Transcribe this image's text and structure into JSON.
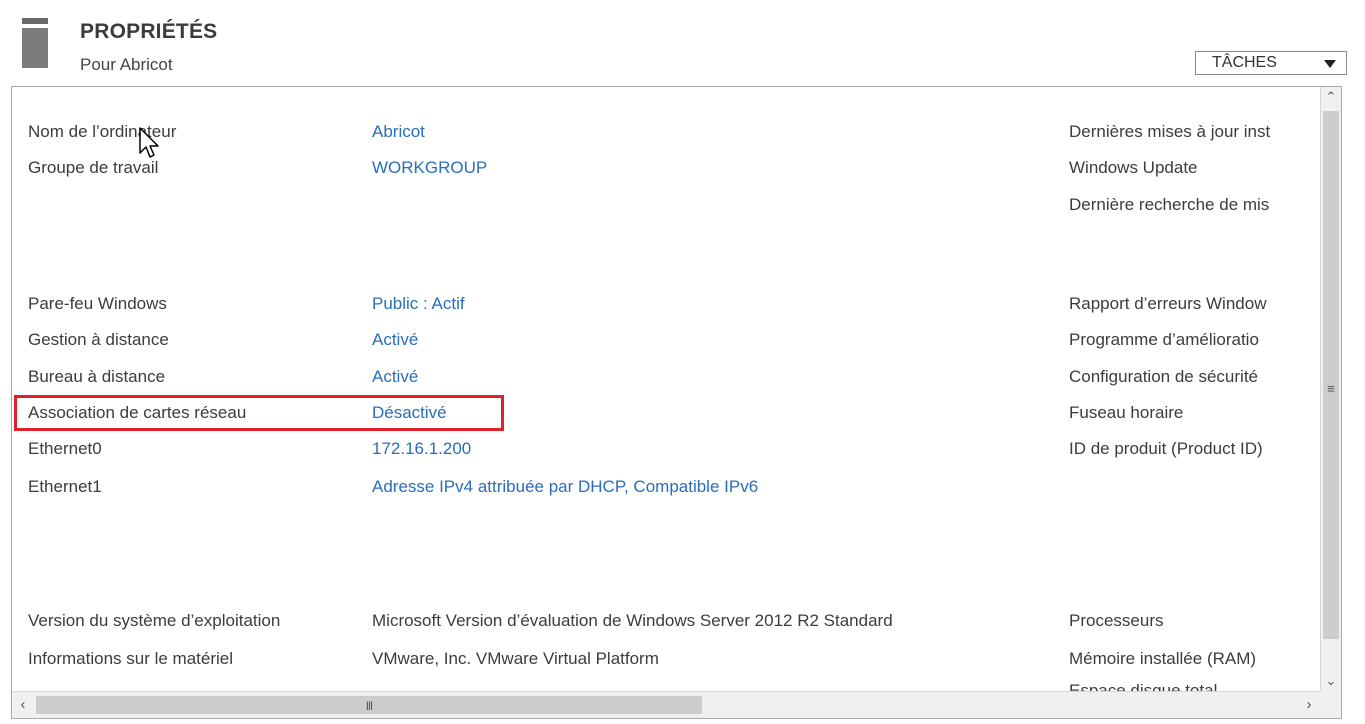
{
  "header": {
    "title": "PROPRIÉTÉS",
    "subtitle": "Pour Abricot",
    "tasks_label": "TÂCHES"
  },
  "properties": {
    "computer_name": {
      "label": "Nom de l’ordinateur",
      "value": "Abricot"
    },
    "workgroup": {
      "label": "Groupe de travail",
      "value": "WORKGROUP"
    },
    "firewall": {
      "label": "Pare-feu Windows",
      "value": "Public : Actif"
    },
    "remote_management": {
      "label": "Gestion à distance",
      "value": "Activé"
    },
    "remote_desktop": {
      "label": "Bureau à distance",
      "value": "Activé"
    },
    "nic_teaming": {
      "label": "Association de cartes réseau",
      "value": "Désactivé"
    },
    "ethernet0": {
      "label": "Ethernet0",
      "value": "172.16.1.200"
    },
    "ethernet1": {
      "label": "Ethernet1",
      "value": "Adresse IPv4 attribuée par DHCP, Compatible IPv6"
    },
    "os_version": {
      "label": "Version du système d’exploitation",
      "value": "Microsoft Version d’évaluation de Windows Server 2012 R2 Standard"
    },
    "hardware": {
      "label": "Informations sur le matériel",
      "value": "VMware, Inc. VMware Virtual Platform"
    }
  },
  "right_column": [
    "Dernières mises à jour inst",
    "Windows Update",
    "Dernière recherche de mis",
    "Rapport d’erreurs Window",
    "Programme d’amélioratio",
    "Configuration de sécurité",
    "Fuseau horaire",
    "ID de produit (Product ID)",
    "Processeurs",
    "Mémoire installée (RAM)",
    "Espace disque total"
  ],
  "colors": {
    "link": "#2a6ebb",
    "highlight": "#e0202a",
    "text": "#3c3c3c"
  }
}
